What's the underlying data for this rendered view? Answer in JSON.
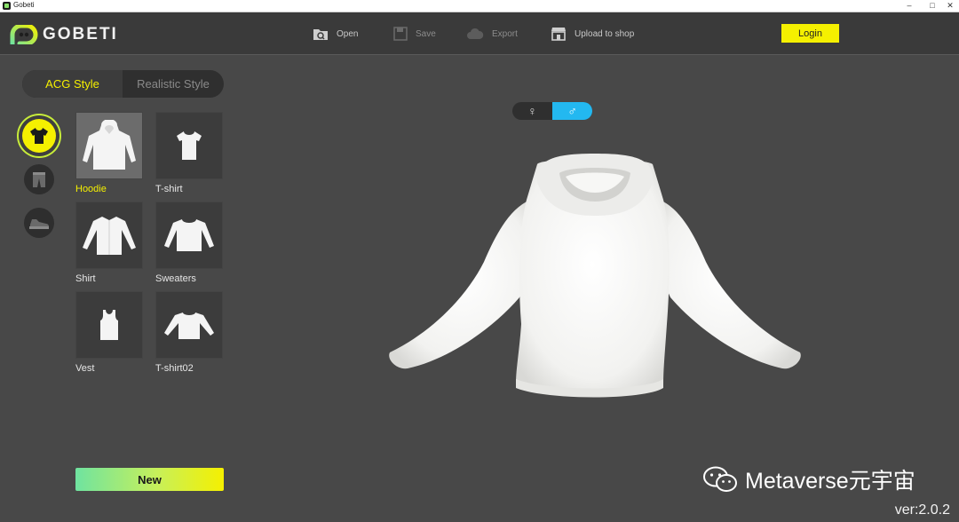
{
  "window": {
    "title": "Gobeti",
    "controls": {
      "minimize": "–",
      "maximize": "□",
      "close": "✕"
    }
  },
  "header": {
    "logo_text": "GOBETI",
    "tools": [
      {
        "label": "Open",
        "icon": "folder-search-icon"
      },
      {
        "label": "Save",
        "icon": "save-icon"
      },
      {
        "label": "Export",
        "icon": "cloud-export-icon"
      },
      {
        "label": "Upload to shop",
        "icon": "shop-icon"
      }
    ],
    "login_label": "Login"
  },
  "style_tabs": {
    "active": "ACG Style",
    "inactive": "Realistic Style"
  },
  "categories": [
    {
      "name": "tops",
      "icon": "tshirt-icon",
      "active": true
    },
    {
      "name": "bottoms",
      "icon": "pants-icon",
      "active": false
    },
    {
      "name": "shoes",
      "icon": "sneaker-icon",
      "active": false
    }
  ],
  "garments": [
    {
      "label": "Hoodie",
      "selected": true
    },
    {
      "label": "T-shirt",
      "selected": false
    },
    {
      "label": "Shirt",
      "selected": false
    },
    {
      "label": "Sweaters",
      "selected": false
    },
    {
      "label": "Vest",
      "selected": false
    },
    {
      "label": "T-shirt02",
      "selected": false
    }
  ],
  "new_label": "New",
  "gender": {
    "female": "♀",
    "male": "♂",
    "selected": "male"
  },
  "watermark": {
    "text": "Metaverse元宇宙",
    "icon": "wechat-icon"
  },
  "version": "ver:2.0.2",
  "colors": {
    "accent": "#f5f000",
    "male_active": "#23b8f0",
    "background": "#484848"
  }
}
